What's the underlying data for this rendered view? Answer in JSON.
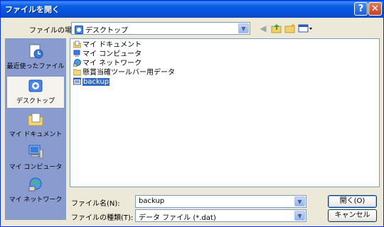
{
  "window": {
    "title": "ファイルを開く"
  },
  "lookin": {
    "label": "ファイルの場所(I):",
    "value": "デスクトップ"
  },
  "places": [
    {
      "label": "最近使ったファイル"
    },
    {
      "label": "デスクトップ"
    },
    {
      "label": "マイ ドキュメント"
    },
    {
      "label": "マイ コンピュータ"
    },
    {
      "label": "マイ ネットワーク"
    }
  ],
  "files": [
    {
      "name": "マイ ドキュメント",
      "icon": "documents-icon"
    },
    {
      "name": "マイ コンピュータ",
      "icon": "computer-icon"
    },
    {
      "name": "マイ ネットワーク",
      "icon": "network-icon"
    },
    {
      "name": "懸賞当確ツールバー用データ",
      "icon": "folder-icon"
    },
    {
      "name": "backup",
      "icon": "data-file-icon"
    }
  ],
  "filename": {
    "label": "ファイル名(N):",
    "value": "backup"
  },
  "filetype": {
    "label": "ファイルの種類(T):",
    "value": "データ ファイル (*.dat)"
  },
  "buttons": {
    "open": "開く(O)",
    "cancel": "キャンセル"
  },
  "colors": {
    "titlebar": "#0b5fe6",
    "selection": "#316ac5",
    "places_bg": "#8a9bd0"
  }
}
